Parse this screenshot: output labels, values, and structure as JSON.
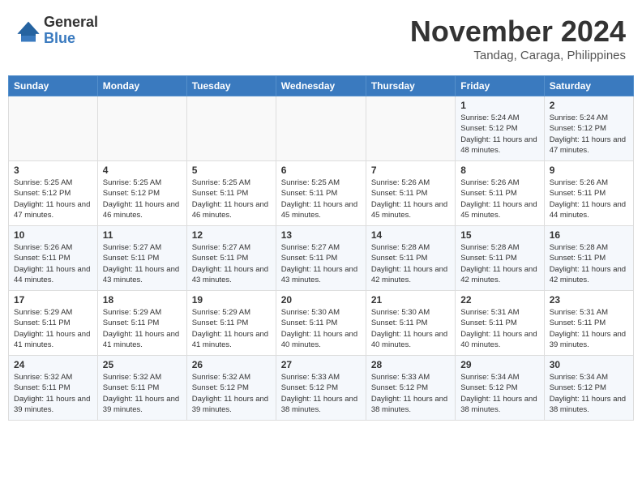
{
  "header": {
    "logo_general": "General",
    "logo_blue": "Blue",
    "month_title": "November 2024",
    "location": "Tandag, Caraga, Philippines"
  },
  "days_of_week": [
    "Sunday",
    "Monday",
    "Tuesday",
    "Wednesday",
    "Thursday",
    "Friday",
    "Saturday"
  ],
  "weeks": [
    [
      {
        "day": "",
        "info": ""
      },
      {
        "day": "",
        "info": ""
      },
      {
        "day": "",
        "info": ""
      },
      {
        "day": "",
        "info": ""
      },
      {
        "day": "",
        "info": ""
      },
      {
        "day": "1",
        "info": "Sunrise: 5:24 AM\nSunset: 5:12 PM\nDaylight: 11 hours and 48 minutes."
      },
      {
        "day": "2",
        "info": "Sunrise: 5:24 AM\nSunset: 5:12 PM\nDaylight: 11 hours and 47 minutes."
      }
    ],
    [
      {
        "day": "3",
        "info": "Sunrise: 5:25 AM\nSunset: 5:12 PM\nDaylight: 11 hours and 47 minutes."
      },
      {
        "day": "4",
        "info": "Sunrise: 5:25 AM\nSunset: 5:12 PM\nDaylight: 11 hours and 46 minutes."
      },
      {
        "day": "5",
        "info": "Sunrise: 5:25 AM\nSunset: 5:11 PM\nDaylight: 11 hours and 46 minutes."
      },
      {
        "day": "6",
        "info": "Sunrise: 5:25 AM\nSunset: 5:11 PM\nDaylight: 11 hours and 45 minutes."
      },
      {
        "day": "7",
        "info": "Sunrise: 5:26 AM\nSunset: 5:11 PM\nDaylight: 11 hours and 45 minutes."
      },
      {
        "day": "8",
        "info": "Sunrise: 5:26 AM\nSunset: 5:11 PM\nDaylight: 11 hours and 45 minutes."
      },
      {
        "day": "9",
        "info": "Sunrise: 5:26 AM\nSunset: 5:11 PM\nDaylight: 11 hours and 44 minutes."
      }
    ],
    [
      {
        "day": "10",
        "info": "Sunrise: 5:26 AM\nSunset: 5:11 PM\nDaylight: 11 hours and 44 minutes."
      },
      {
        "day": "11",
        "info": "Sunrise: 5:27 AM\nSunset: 5:11 PM\nDaylight: 11 hours and 43 minutes."
      },
      {
        "day": "12",
        "info": "Sunrise: 5:27 AM\nSunset: 5:11 PM\nDaylight: 11 hours and 43 minutes."
      },
      {
        "day": "13",
        "info": "Sunrise: 5:27 AM\nSunset: 5:11 PM\nDaylight: 11 hours and 43 minutes."
      },
      {
        "day": "14",
        "info": "Sunrise: 5:28 AM\nSunset: 5:11 PM\nDaylight: 11 hours and 42 minutes."
      },
      {
        "day": "15",
        "info": "Sunrise: 5:28 AM\nSunset: 5:11 PM\nDaylight: 11 hours and 42 minutes."
      },
      {
        "day": "16",
        "info": "Sunrise: 5:28 AM\nSunset: 5:11 PM\nDaylight: 11 hours and 42 minutes."
      }
    ],
    [
      {
        "day": "17",
        "info": "Sunrise: 5:29 AM\nSunset: 5:11 PM\nDaylight: 11 hours and 41 minutes."
      },
      {
        "day": "18",
        "info": "Sunrise: 5:29 AM\nSunset: 5:11 PM\nDaylight: 11 hours and 41 minutes."
      },
      {
        "day": "19",
        "info": "Sunrise: 5:29 AM\nSunset: 5:11 PM\nDaylight: 11 hours and 41 minutes."
      },
      {
        "day": "20",
        "info": "Sunrise: 5:30 AM\nSunset: 5:11 PM\nDaylight: 11 hours and 40 minutes."
      },
      {
        "day": "21",
        "info": "Sunrise: 5:30 AM\nSunset: 5:11 PM\nDaylight: 11 hours and 40 minutes."
      },
      {
        "day": "22",
        "info": "Sunrise: 5:31 AM\nSunset: 5:11 PM\nDaylight: 11 hours and 40 minutes."
      },
      {
        "day": "23",
        "info": "Sunrise: 5:31 AM\nSunset: 5:11 PM\nDaylight: 11 hours and 39 minutes."
      }
    ],
    [
      {
        "day": "24",
        "info": "Sunrise: 5:32 AM\nSunset: 5:11 PM\nDaylight: 11 hours and 39 minutes."
      },
      {
        "day": "25",
        "info": "Sunrise: 5:32 AM\nSunset: 5:11 PM\nDaylight: 11 hours and 39 minutes."
      },
      {
        "day": "26",
        "info": "Sunrise: 5:32 AM\nSunset: 5:12 PM\nDaylight: 11 hours and 39 minutes."
      },
      {
        "day": "27",
        "info": "Sunrise: 5:33 AM\nSunset: 5:12 PM\nDaylight: 11 hours and 38 minutes."
      },
      {
        "day": "28",
        "info": "Sunrise: 5:33 AM\nSunset: 5:12 PM\nDaylight: 11 hours and 38 minutes."
      },
      {
        "day": "29",
        "info": "Sunrise: 5:34 AM\nSunset: 5:12 PM\nDaylight: 11 hours and 38 minutes."
      },
      {
        "day": "30",
        "info": "Sunrise: 5:34 AM\nSunset: 5:12 PM\nDaylight: 11 hours and 38 minutes."
      }
    ]
  ]
}
